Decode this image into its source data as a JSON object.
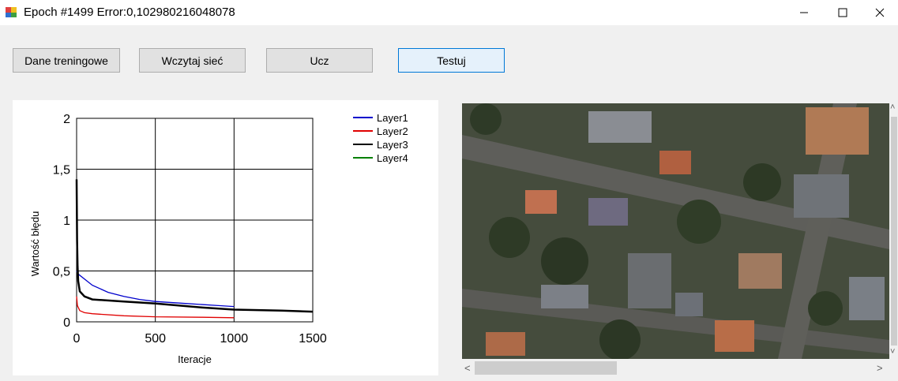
{
  "window": {
    "title": "Epoch #1499 Error:0,102980216048078",
    "icon": "app-icon",
    "controls": [
      "minimize-icon",
      "maximize-icon",
      "close-icon"
    ]
  },
  "toolbar": {
    "training_data_label": "Dane treningowe",
    "load_network_label": "Wczytaj sieć",
    "train_label": "Ucz",
    "test_label": "Testuj"
  },
  "colors": {
    "focus_border": "#0078d7",
    "layer1": "#0000cc",
    "layer2": "#e00000",
    "layer3": "#000000",
    "layer4": "#008000"
  },
  "chart_data": {
    "type": "line",
    "xlabel": "Iteracje",
    "ylabel": "Wartość błędu",
    "xlim": [
      0,
      1500
    ],
    "ylim": [
      0,
      2
    ],
    "x_ticks": [
      "0",
      "500",
      "1000",
      "1500"
    ],
    "y_ticks": [
      "0",
      "0,5",
      "1",
      "1,5",
      "2"
    ],
    "grid": true,
    "legend_position": "top-right",
    "series": [
      {
        "name": "Layer1",
        "color": "#0000cc",
        "points": [
          [
            0,
            0.5
          ],
          [
            10,
            0.47
          ],
          [
            50,
            0.42
          ],
          [
            100,
            0.36
          ],
          [
            200,
            0.29
          ],
          [
            300,
            0.25
          ],
          [
            400,
            0.22
          ],
          [
            500,
            0.2
          ],
          [
            700,
            0.18
          ],
          [
            900,
            0.16
          ],
          [
            1000,
            0.15
          ]
        ]
      },
      {
        "name": "Layer2",
        "color": "#e00000",
        "points": [
          [
            0,
            0.25
          ],
          [
            5,
            0.16
          ],
          [
            20,
            0.11
          ],
          [
            50,
            0.09
          ],
          [
            100,
            0.08
          ],
          [
            300,
            0.06
          ],
          [
            500,
            0.05
          ],
          [
            800,
            0.045
          ],
          [
            1000,
            0.04
          ]
        ]
      },
      {
        "name": "Layer3",
        "color": "#000000",
        "points": [
          [
            0,
            1.4
          ],
          [
            3,
            0.8
          ],
          [
            6,
            0.55
          ],
          [
            10,
            0.4
          ],
          [
            20,
            0.3
          ],
          [
            50,
            0.25
          ],
          [
            100,
            0.22
          ],
          [
            300,
            0.2
          ],
          [
            500,
            0.18
          ],
          [
            800,
            0.14
          ],
          [
            1000,
            0.12
          ],
          [
            1300,
            0.11
          ],
          [
            1499,
            0.1
          ]
        ]
      },
      {
        "name": "Layer4",
        "color": "#008000",
        "points": []
      }
    ]
  },
  "map": {
    "description_icon": "satellite-image"
  }
}
